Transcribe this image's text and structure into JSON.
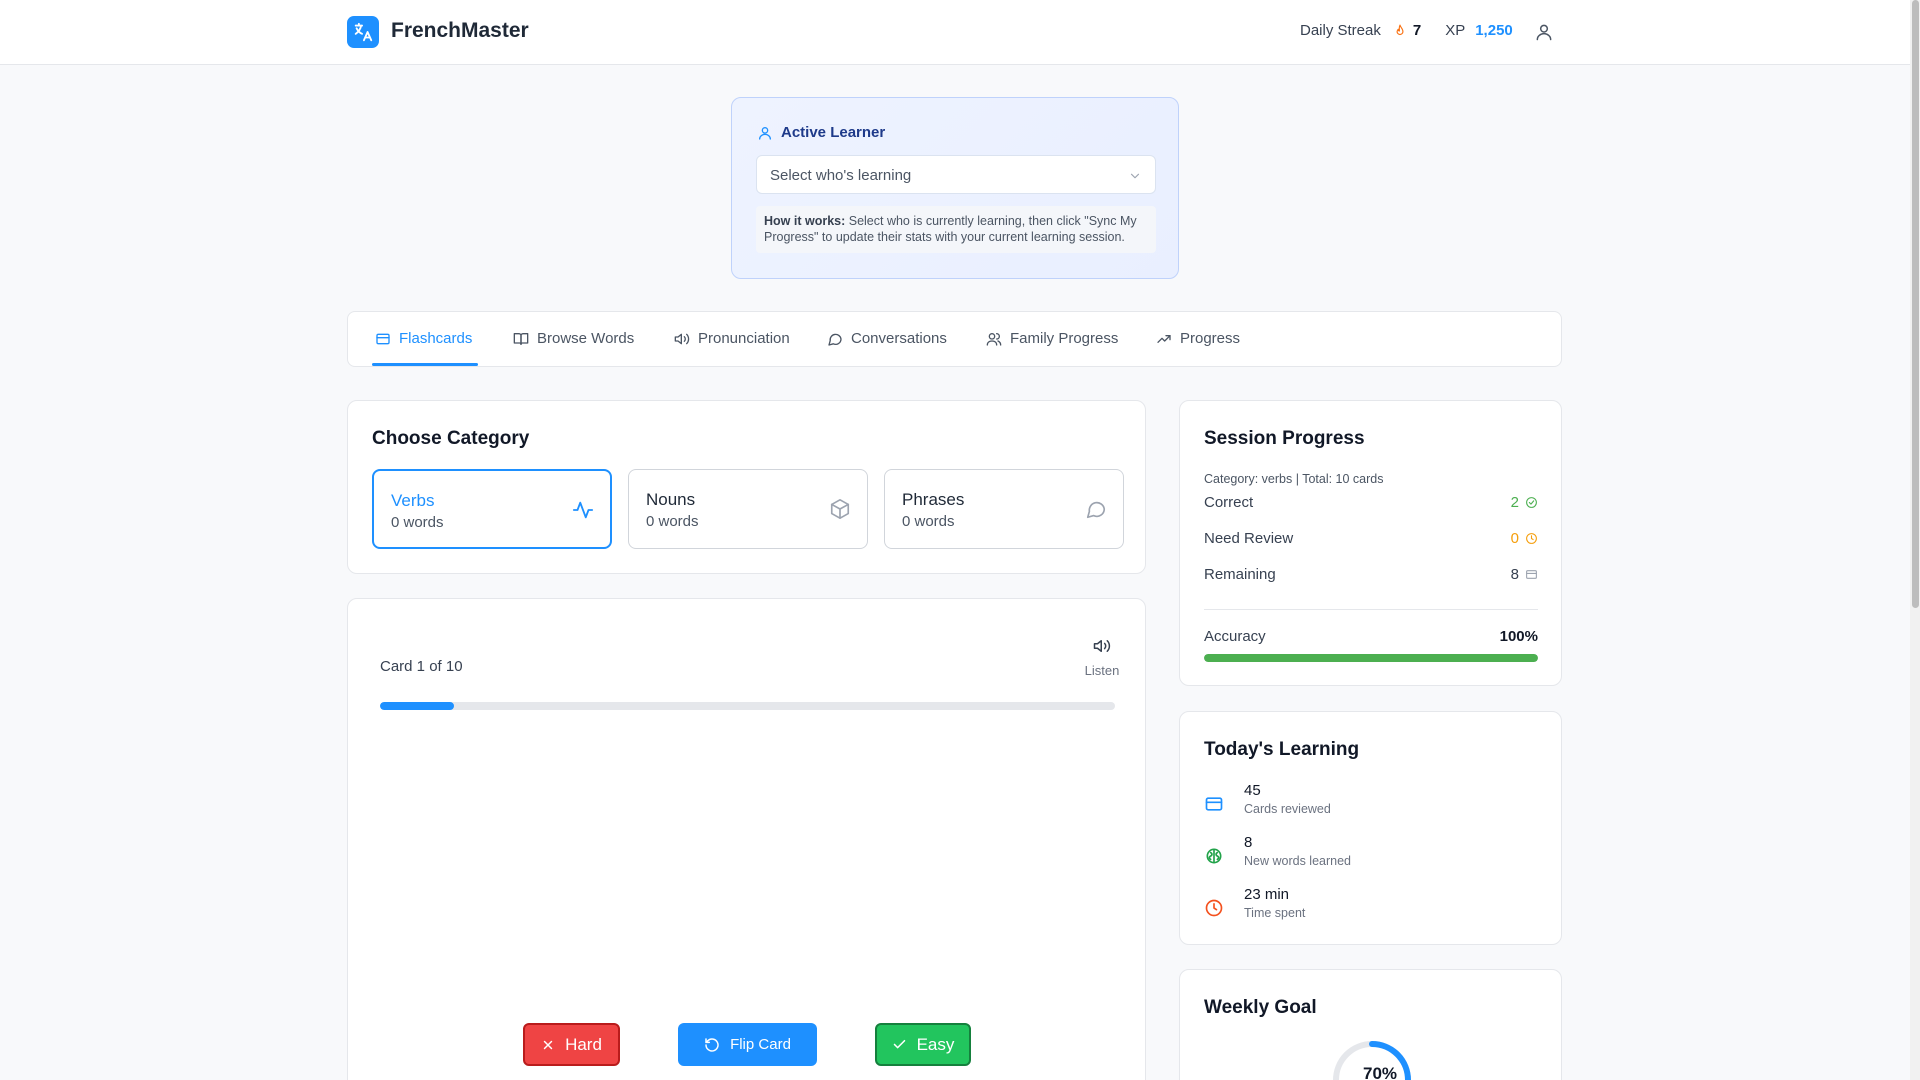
{
  "app": {
    "name": "FrenchMaster",
    "streak_label": "Daily Streak",
    "streak_value": "7",
    "xp_label": "XP",
    "xp_value": "1,250"
  },
  "learner": {
    "title": "Active Learner",
    "select_placeholder": "Select who's learning",
    "howto_bold": "How it works:",
    "howto_text": " Select who is currently learning, then click \"Sync My Progress\" to update their stats with your current learning session."
  },
  "tabs": [
    {
      "label": "Flashcards",
      "icon": "card-icon",
      "active": true
    },
    {
      "label": "Browse Words",
      "icon": "book-icon"
    },
    {
      "label": "Pronunciation",
      "icon": "speaker-icon"
    },
    {
      "label": "Conversations",
      "icon": "chat-icon"
    },
    {
      "label": "Family Progress",
      "icon": "users-icon"
    },
    {
      "label": "Progress",
      "icon": "trending-icon"
    }
  ],
  "categories": {
    "title": "Choose Category",
    "items": [
      {
        "name": "Verbs",
        "count": "0 words",
        "icon": "activity-icon",
        "active": true
      },
      {
        "name": "Nouns",
        "count": "0 words",
        "icon": "box-icon"
      },
      {
        "name": "Phrases",
        "count": "0 words",
        "icon": "chat-icon"
      }
    ]
  },
  "flashcard": {
    "counter": "Card 1 of 10",
    "listen": "Listen",
    "progress_fraction": 0.1,
    "hard": "Hard",
    "flip": "Flip Card",
    "easy": "Easy"
  },
  "session": {
    "title": "Session Progress",
    "subtitle": "Category: verbs | Total: 10 cards",
    "correct_label": "Correct",
    "correct_value": "2",
    "review_label": "Need Review",
    "review_value": "0",
    "remaining_label": "Remaining",
    "remaining_value": "8",
    "accuracy_label": "Accuracy",
    "accuracy_value": "100%",
    "accuracy_fraction": 1.0
  },
  "today": {
    "title": "Today's Learning",
    "items": [
      {
        "value": "45",
        "label": "Cards reviewed",
        "icon": "card-icon"
      },
      {
        "value": "8",
        "label": "New words learned",
        "icon": "brain-icon"
      },
      {
        "value": "23 min",
        "label": "Time spent",
        "icon": "clock-icon"
      }
    ]
  },
  "weekly": {
    "title": "Weekly Goal",
    "percent": "70%",
    "fraction": 0.7
  },
  "colors": {
    "accent": "#1e90ff",
    "success": "#4caf50",
    "warning": "#f59e0b",
    "danger": "#ef4444"
  }
}
